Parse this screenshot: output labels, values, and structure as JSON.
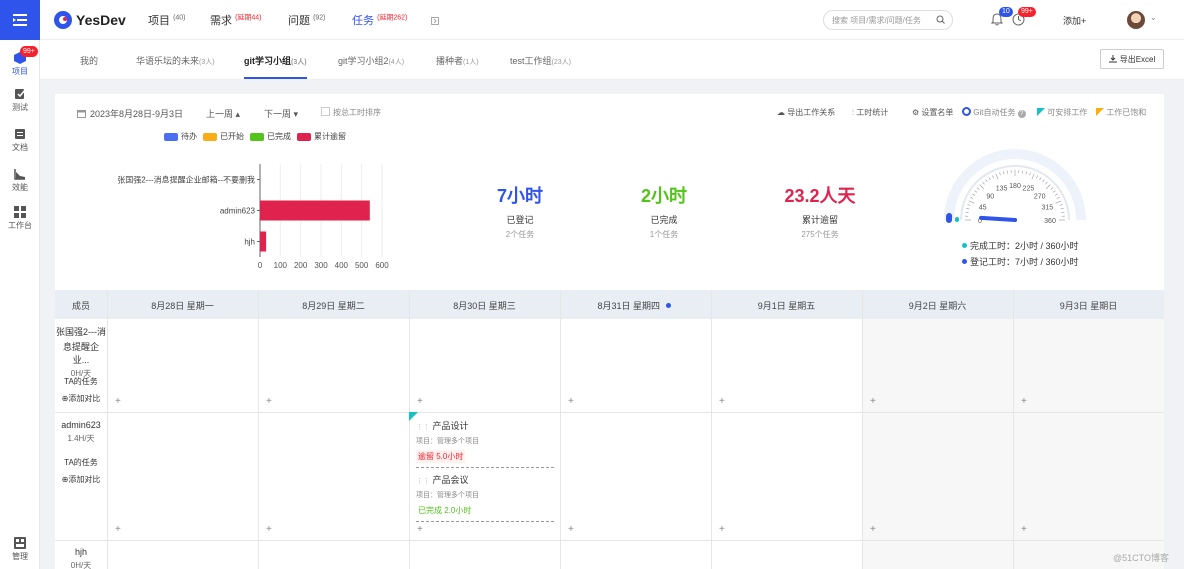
{
  "sidebar": {
    "menu_icon": "menu-icon",
    "items": [
      {
        "label": "项目",
        "icon": "project-icon",
        "badge": "99+"
      },
      {
        "label": "测试",
        "icon": "test-icon"
      },
      {
        "label": "文档",
        "icon": "doc-icon"
      },
      {
        "label": "效能",
        "icon": "efficiency-icon"
      },
      {
        "label": "工作台",
        "icon": "workbench-icon"
      },
      {
        "label": "管理",
        "icon": "manage-icon"
      }
    ]
  },
  "header": {
    "logo": "YesDev",
    "nav": [
      {
        "label": "项目",
        "count": "(40)"
      },
      {
        "label": "需求",
        "count": "(延期44)"
      },
      {
        "label": "问题",
        "count": "(92)"
      },
      {
        "label": "任务",
        "count": "(延期262)"
      }
    ],
    "search_placeholder": "搜索 项目/需求/问题/任务",
    "notification_badge": "10",
    "clock_badge": "99+",
    "add_label": "添加+"
  },
  "tabs": [
    {
      "label": "我的",
      "count": ""
    },
    {
      "label": "华语乐坛的未来",
      "count": "(3人)"
    },
    {
      "label": "git学习小组",
      "count": "(3人)"
    },
    {
      "label": "git学习小组2",
      "count": "(4人)"
    },
    {
      "label": "播种者",
      "count": "(1人)"
    },
    {
      "label": "test工作组",
      "count": "(23人)"
    }
  ],
  "export_excel": "导出Excel",
  "controls": {
    "date_range": "2023年8月28日-9月3日",
    "prev_week": "上一周",
    "next_week": "下一周",
    "sort_by_hours": "按总工时排序",
    "export_relation": "导出工作关系",
    "hours_stats": "工时统计",
    "set_list": "设置名单",
    "git_auto_task": "Git自动任务",
    "can_schedule": "可安排工作",
    "saturated": "工作已饱和"
  },
  "legend": [
    {
      "label": "待办",
      "color": "#4e6ef2"
    },
    {
      "label": "已开始",
      "color": "#faad14"
    },
    {
      "label": "已完成",
      "color": "#52c41a"
    },
    {
      "label": "累计逾留",
      "color": "#e0234e"
    }
  ],
  "chart_data": {
    "type": "bar",
    "orientation": "horizontal",
    "categories": [
      "张国强2---消息提醒企业邮箱--不要删我",
      "admin623",
      "hjh"
    ],
    "series": [
      {
        "name": "待办",
        "values": [
          0,
          0,
          0
        ]
      },
      {
        "name": "已开始",
        "values": [
          0,
          0,
          0
        ]
      },
      {
        "name": "已完成",
        "values": [
          0,
          0,
          0
        ]
      },
      {
        "name": "累计逾留",
        "values": [
          0,
          540,
          30
        ]
      }
    ],
    "xticks": [
      "0",
      "100",
      "200",
      "300",
      "400",
      "500",
      "600"
    ],
    "xlim": [
      0,
      600
    ],
    "grid": true
  },
  "stats": [
    {
      "value": "7小时",
      "label": "已登记",
      "sub": "2个任务",
      "color": "#2f54eb"
    },
    {
      "value": "2小时",
      "label": "已完成",
      "sub": "1个任务",
      "color": "#52c41a"
    },
    {
      "value": "23.2人天",
      "label": "累计逾留",
      "sub": "275个任务",
      "color": "#e0234e"
    }
  ],
  "gauge": {
    "ticks": [
      "0",
      "45",
      "90",
      "135",
      "180",
      "225",
      "270",
      "315",
      "360"
    ],
    "max": 360,
    "completed": 2,
    "registered": 7,
    "completed_label": "完成工时：2小时 / 360小时",
    "registered_label": "登记工时：7小时 / 360小时"
  },
  "calendar": {
    "member_header": "成员",
    "days": [
      "8月28日 星期一",
      "8月29日 星期二",
      "8月30日 星期三",
      "8月31日 星期四",
      "9月1日 星期五",
      "9月2日 星期六",
      "9月3日 星期日"
    ],
    "members": [
      {
        "name_line1": "张国强2---消",
        "name_line2": "息提醒企业...",
        "hours": "0H/天",
        "tasks_link": "TA的任务",
        "compare_link": "添加对比"
      },
      {
        "name_line1": "admin623",
        "name_line2": "",
        "hours": "1.4H/天",
        "tasks_link": "TA的任务",
        "compare_link": "添加对比"
      },
      {
        "name_line1": "hjh",
        "name_line2": "",
        "hours": "0H/天"
      }
    ],
    "tasks": [
      {
        "title": "产品设计",
        "project": "项目：管理多个项目",
        "status": "逾留 5.0小时",
        "status_color": "#f5222d",
        "status_bg": "#fff1f0"
      },
      {
        "title": "产品会议",
        "project": "项目：管理多个项目",
        "status": "已完成 2.0小时",
        "status_color": "#52c41a",
        "status_bg": "#ffffff"
      }
    ]
  },
  "watermark": "@51CTO博客"
}
